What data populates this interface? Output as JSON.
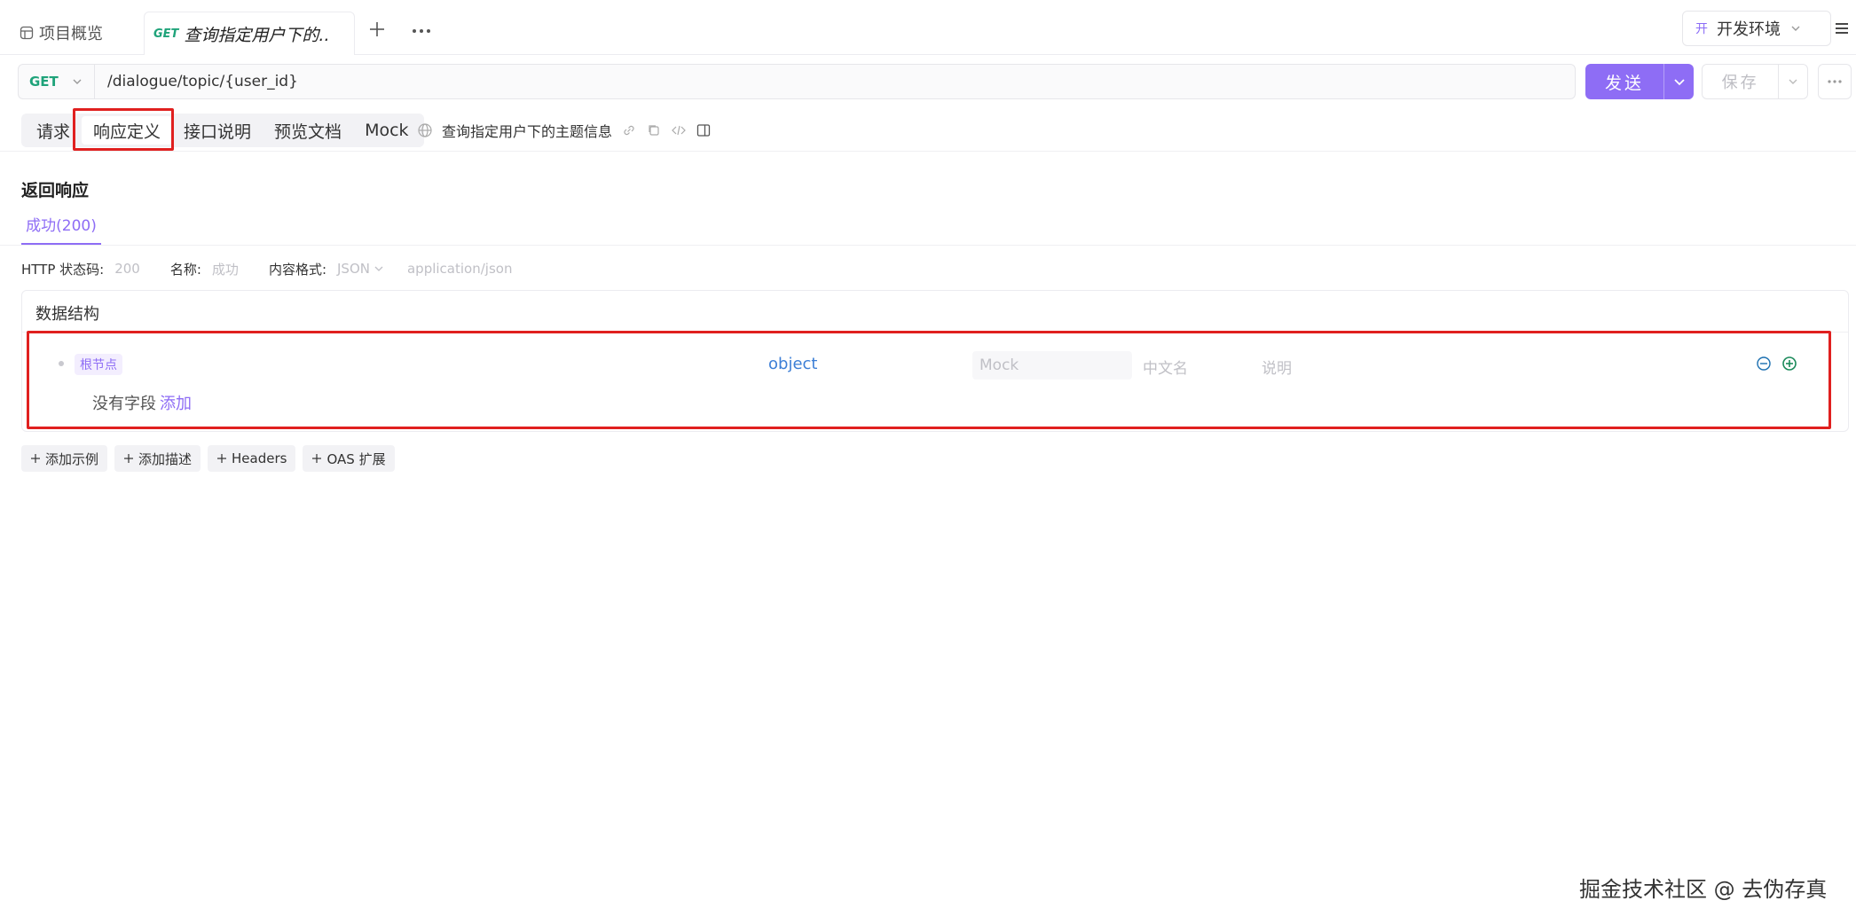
{
  "tabs": {
    "overview_label": "项目概览",
    "active_method": "GET",
    "active_name": "查询指定用户下的.."
  },
  "environment": {
    "tag": "开",
    "name": "开发环境"
  },
  "request": {
    "method": "GET",
    "url": "/dialogue/topic/{user_id}",
    "send_label": "发送",
    "save_label": "保存"
  },
  "subtabs": [
    "请求",
    "响应定义",
    "接口说明",
    "预览文档",
    "Mock"
  ],
  "interface_title": "查询指定用户下的主题信息",
  "response": {
    "section_title": "返回响应",
    "tab_label": "成功(200)",
    "status_label": "HTTP 状态码:",
    "status_value": "200",
    "name_label": "名称:",
    "name_value": "成功",
    "format_label": "内容格式:",
    "format_value": "JSON",
    "content_type": "application/json"
  },
  "schema": {
    "title": "数据结构",
    "root_label": "根节点",
    "root_type": "object",
    "mock_placeholder": "Mock",
    "cn_name_placeholder": "中文名",
    "desc_placeholder": "说明",
    "empty_text": "没有字段",
    "add_link": "添加"
  },
  "actions": [
    "添加示例",
    "添加描述",
    "Headers",
    "OAS 扩展"
  ],
  "watermark": "掘金技术社区 @ 去伪存真",
  "colors": {
    "accent": "#8e6df5",
    "get_method": "#1fa37a",
    "type_blue": "#3d7fd6",
    "highlight": "#e0201f"
  }
}
